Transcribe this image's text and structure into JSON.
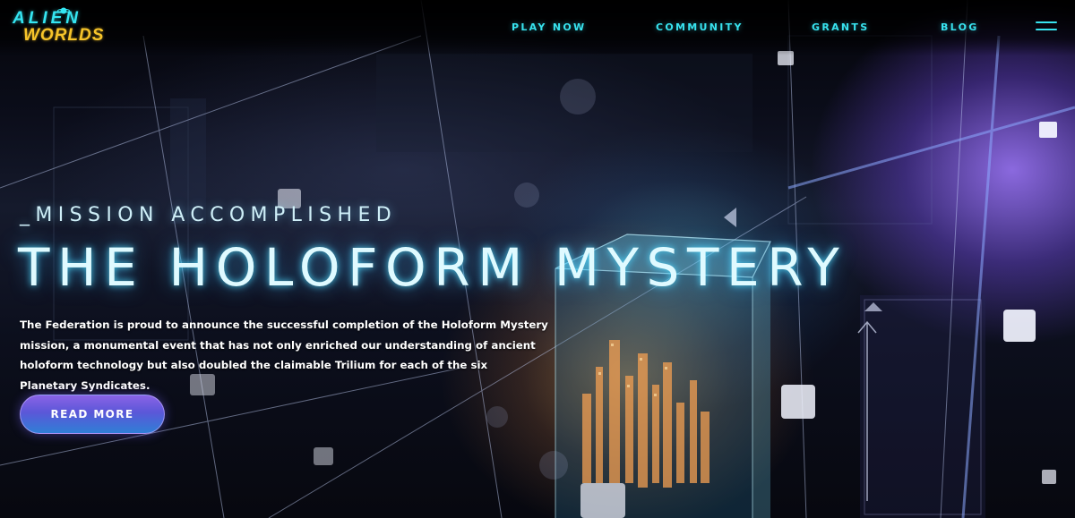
{
  "header": {
    "logo": {
      "line1": "ALIEN",
      "line2": "WORLDS"
    },
    "nav": [
      {
        "label": "PLAY NOW"
      },
      {
        "label": "COMMUNITY"
      },
      {
        "label": "GRANTS"
      },
      {
        "label": "BLOG"
      }
    ],
    "menu_icon": "hamburger-menu-icon"
  },
  "hero": {
    "eyebrow": "_MISSION ACCOMPLISHED",
    "headline": "THE HOLOFORM MYSTERY",
    "description": "The Federation is proud to announce the successful completion of the Holoform Mystery mission, a monumental event that has not only enriched our understanding of ancient holoform technology but also doubled the claimable Trilium for each of the six Planetary Syndicates.",
    "cta_label": "READ MORE"
  },
  "colors": {
    "accent_cyan": "#38e3ef",
    "logo_yellow": "#f6c42a",
    "button_purple": "#8a63e6",
    "button_blue": "#2f7fd6",
    "background": "#05070f"
  }
}
